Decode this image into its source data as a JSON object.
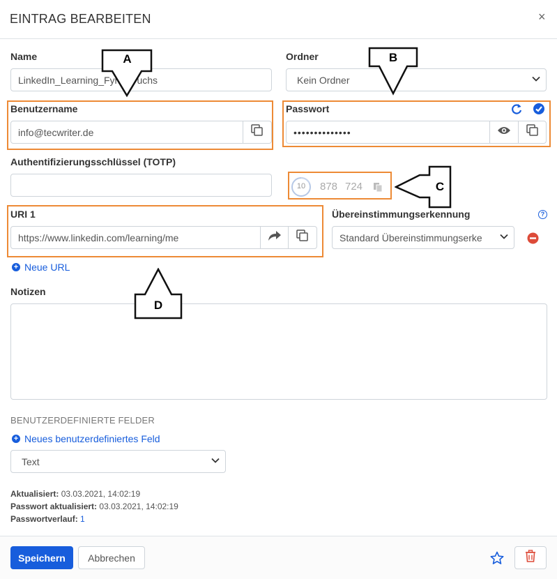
{
  "dialog": {
    "title": "EINTRAG BEARBEITEN",
    "close": "×"
  },
  "name": {
    "label": "Name",
    "value": "LinkedIn_Learning_Fynn_Fuchs"
  },
  "folder": {
    "label": "Ordner",
    "value": "Kein Ordner"
  },
  "username": {
    "label": "Benutzername",
    "value": "info@tecwriter.de"
  },
  "password": {
    "label": "Passwort",
    "value": "••••••••••••••"
  },
  "totp": {
    "label": "Authentifizierungsschlüssel (TOTP)",
    "value": "",
    "seconds": "10",
    "code_a": "878",
    "code_b": "724"
  },
  "uri": {
    "label": "URI 1",
    "value": "https://www.linkedin.com/learning/me"
  },
  "match": {
    "label": "Übereinstimmungserkennung",
    "value": "Standard Übereinstimmungserke",
    "help": "?"
  },
  "new_url": "Neue URL",
  "notes": {
    "label": "Notizen",
    "value": ""
  },
  "custom_fields": {
    "heading": "BENUTZERDEFINIERTE FELDER",
    "add": "Neues benutzerdefiniertes Feld",
    "type": "Text"
  },
  "metadata": {
    "updated_label": "Aktualisiert:",
    "updated": "03.03.2021, 14:02:19",
    "pw_updated_label": "Passwort aktualisiert:",
    "pw_updated": "03.03.2021, 14:02:19",
    "history_label": "Passwortverlauf:",
    "history": "1"
  },
  "footer": {
    "save": "Speichern",
    "cancel": "Abbrechen"
  },
  "callouts": {
    "a": "A",
    "b": "B",
    "c": "C",
    "d": "D"
  },
  "colors": {
    "accent": "#175ddc",
    "highlight": "#ed8a35",
    "danger": "#dd4b39"
  },
  "icons": [
    "close-icon",
    "copy-icon",
    "eye-icon",
    "refresh-icon",
    "check-circle-icon",
    "totp-copy-icon",
    "launch-icon",
    "help-icon",
    "remove-icon",
    "plus-circle-icon",
    "star-icon",
    "trash-icon"
  ]
}
